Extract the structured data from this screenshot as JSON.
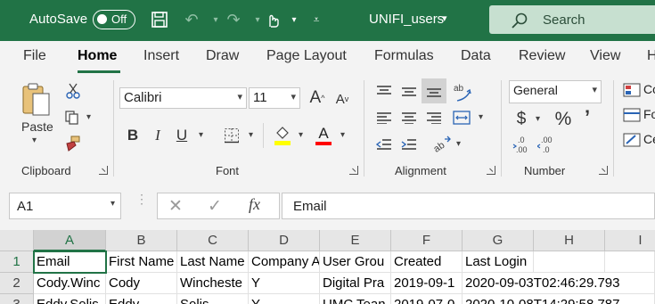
{
  "titlebar": {
    "autosave_label": "AutoSave",
    "autosave_state": "Off",
    "filename": "UNIFI_users",
    "search_label": "Search"
  },
  "tabs": [
    {
      "label": "File"
    },
    {
      "label": "Home"
    },
    {
      "label": "Insert"
    },
    {
      "label": "Draw"
    },
    {
      "label": "Page Layout"
    },
    {
      "label": "Formulas"
    },
    {
      "label": "Data"
    },
    {
      "label": "Review"
    },
    {
      "label": "View"
    },
    {
      "label": "H"
    }
  ],
  "ribbon": {
    "clipboard": {
      "label": "Clipboard",
      "paste_label": "Paste"
    },
    "font": {
      "label": "Font",
      "font_name": "Calibri",
      "font_size": "11",
      "bold": "B",
      "italic": "I",
      "underline": "U",
      "grow": "A",
      "shrink": "A",
      "font_color_letter": "A",
      "fill_color": "#ffff00",
      "font_color": "#ff0000"
    },
    "alignment": {
      "label": "Alignment"
    },
    "number": {
      "label": "Number",
      "format": "General",
      "currency": "$",
      "percent": "%",
      "comma": "’",
      "inc_decimal": ".00 →.0",
      "dec_decimal": ".00"
    },
    "styles": {
      "items": [
        "Co",
        "Fo",
        "Ce"
      ]
    }
  },
  "formulabar": {
    "namebox": "A1",
    "fx": "fx",
    "content": "Email"
  },
  "grid": {
    "columns": [
      "A",
      "B",
      "C",
      "D",
      "E",
      "F",
      "G",
      "H",
      "I"
    ],
    "rows": [
      {
        "num": "1",
        "cells": [
          "Email",
          "First Name",
          "Last Name",
          "Company A",
          "User Grou",
          "Created",
          "Last Login",
          "",
          ""
        ]
      },
      {
        "num": "2",
        "cells": [
          "Cody.Winc",
          "Cody",
          "Wincheste",
          "Y",
          "Digital Pra",
          "2019-09-1",
          "2020-09-03T02:46:29.793",
          "",
          ""
        ]
      },
      {
        "num": "3",
        "cells": [
          "Eddy.Solis",
          "Eddy",
          "Solis",
          "Y",
          "UMC Tean",
          "2019-07-0",
          "2020-10-08T14:29:58.787",
          "",
          ""
        ]
      }
    ]
  },
  "colors": {
    "accent": "#217346",
    "search_bg": "#c7e0d0"
  }
}
